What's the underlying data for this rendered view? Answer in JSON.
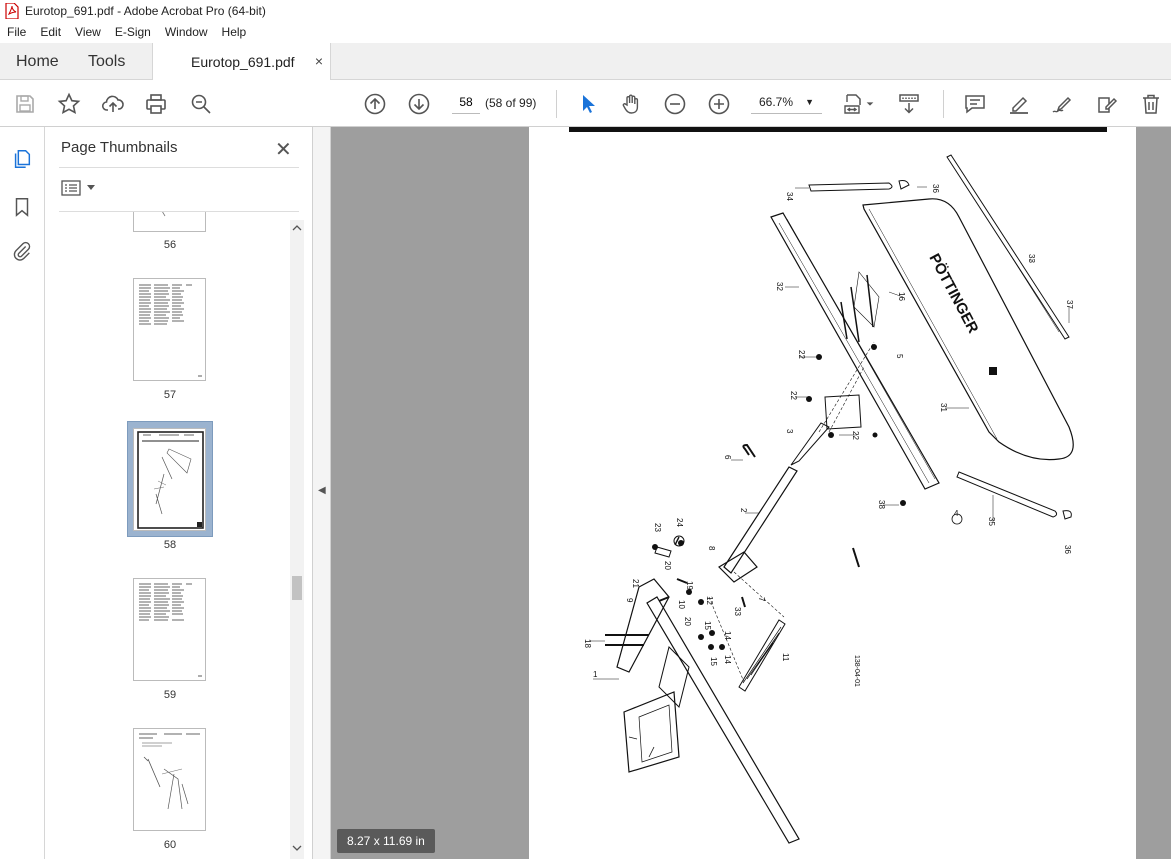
{
  "window": {
    "title": "Eurotop_691.pdf - Adobe Acrobat Pro (64-bit)"
  },
  "menu": [
    "File",
    "Edit",
    "View",
    "E-Sign",
    "Window",
    "Help"
  ],
  "tabs": {
    "home": "Home",
    "tools": "Tools",
    "document": "Eurotop_691.pdf",
    "close": "×"
  },
  "toolbar": {
    "page_number": "58",
    "page_count": "(58 of 99)",
    "zoom": "66.7%"
  },
  "panel": {
    "title": "Page Thumbnails",
    "close": "✕",
    "thumbnails": [
      {
        "label": "56"
      },
      {
        "label": "57"
      },
      {
        "label": "58",
        "selected": true
      },
      {
        "label": "59"
      },
      {
        "label": "60"
      }
    ]
  },
  "status": {
    "page_size": "8.27 x 11.69 in"
  },
  "drawing": {
    "brand": "PÖTTINGER",
    "ref": "138-04-01",
    "callouts": [
      "34",
      "36",
      "33",
      "37",
      "32",
      "16",
      "5",
      "22",
      "22",
      "22",
      "3",
      "31",
      "6",
      "2",
      "38",
      "35",
      "36",
      "4",
      "23",
      "24",
      "8",
      "20",
      "21",
      "19",
      "9",
      "10",
      "12",
      "7",
      "33",
      "18",
      "20",
      "15",
      "14",
      "15",
      "14",
      "11",
      "1"
    ]
  }
}
